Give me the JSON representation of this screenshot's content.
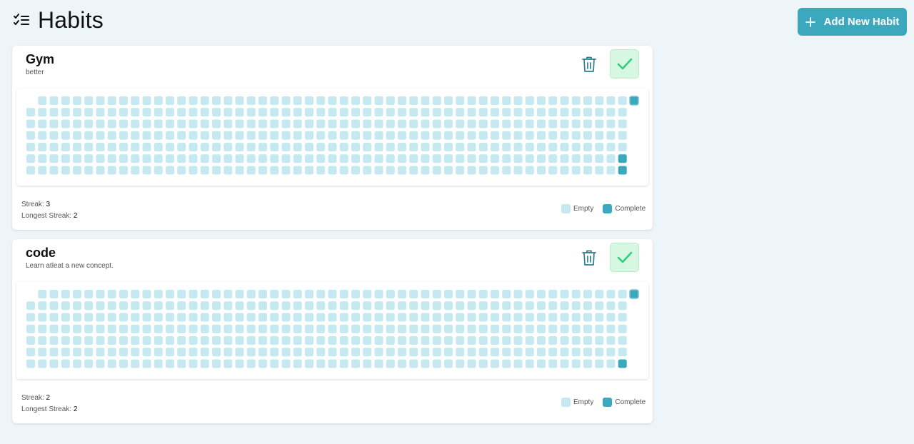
{
  "header": {
    "title": "Habits",
    "add_button_label": "Add New Habit"
  },
  "colors": {
    "accent": "#3ba8bd",
    "empty_cell": "#c5e8f1",
    "complete_cell": "#3ba8bd",
    "done_check": "#2fcf78"
  },
  "habits": [
    {
      "name": "Gym",
      "description": "better",
      "streak_label": "Streak:",
      "streak": "3",
      "longest_streak_label": "Longest Streak:",
      "longest_streak": "2",
      "legend_empty": "Empty",
      "legend_complete": "Complete",
      "complete_days_from_end": [
        0,
        1,
        2
      ]
    },
    {
      "name": "code",
      "description": "Learn atleat a new concept.",
      "streak_label": "Streak:",
      "streak": "2",
      "longest_streak_label": "Longest Streak:",
      "longest_streak": "2",
      "legend_empty": "Empty",
      "legend_complete": "Complete",
      "complete_days_from_end": [
        0,
        1
      ]
    }
  ]
}
